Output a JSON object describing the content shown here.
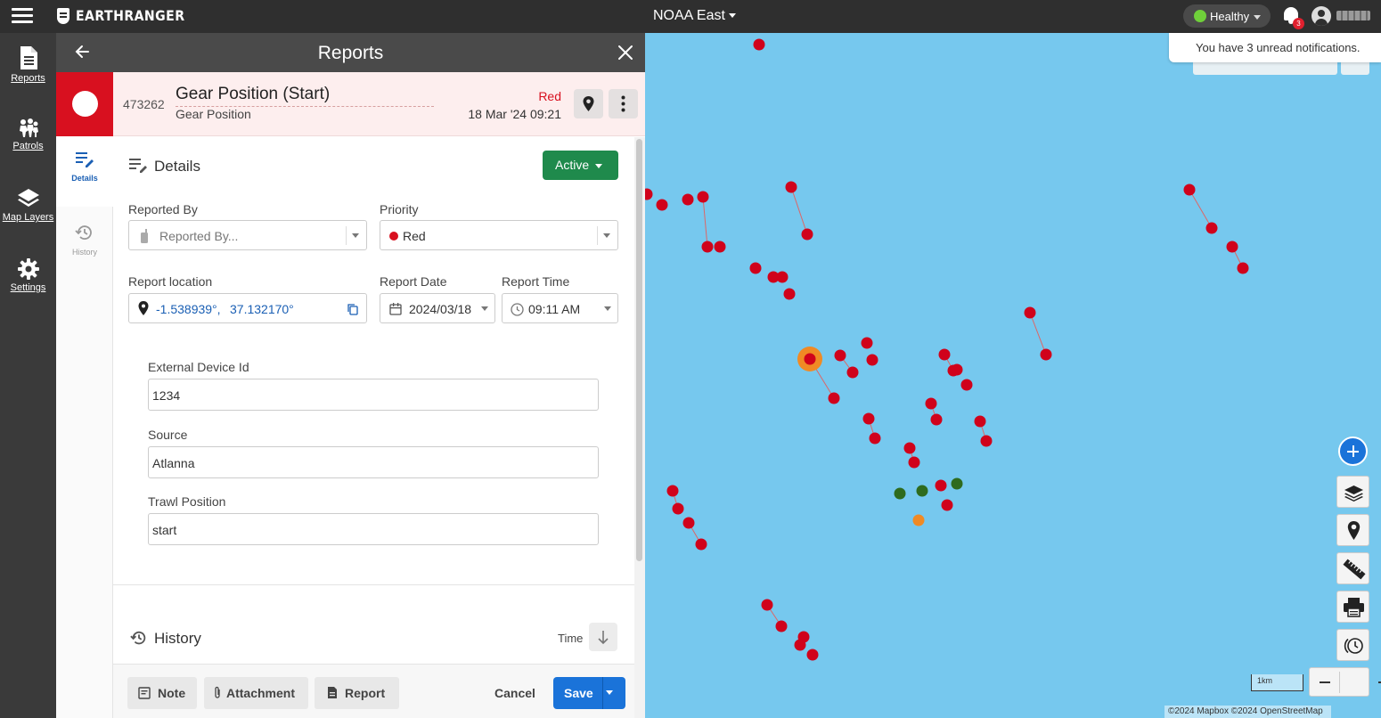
{
  "topbar": {
    "brand": "EARTHRANGER",
    "map_name": "NOAA East",
    "health_status": "Healthy",
    "notification_count": "3"
  },
  "notification_toast": "You have 3 unread notifications.",
  "left_nav": {
    "items": [
      {
        "label": "Reports",
        "icon": "document-icon"
      },
      {
        "label": "Patrols",
        "icon": "patrol-icon"
      },
      {
        "label": "Map Layers",
        "icon": "layers-icon"
      },
      {
        "label": "Settings",
        "icon": "gear-icon"
      }
    ]
  },
  "panel": {
    "title": "Reports",
    "report": {
      "serial": "473262",
      "title": "Gear Position (Start)",
      "type": "Gear Position",
      "priority_label": "Red",
      "date": "18 Mar '24 09:21",
      "priority_color": "#d8101f"
    },
    "subnav": {
      "details": "Details",
      "history": "History"
    },
    "details": {
      "section_title": "Details",
      "status": "Active",
      "reported_by_label": "Reported By",
      "reported_by_placeholder": "Reported By...",
      "priority_label": "Priority",
      "priority_value": "Red",
      "location_label": "Report location",
      "latitude": "-1.538939°,",
      "longitude": "37.132170°",
      "date_label": "Report Date",
      "date_value": "2024/03/18",
      "time_label": "Report Time",
      "time_value": "09:11 AM",
      "external_id_label": "External Device Id",
      "external_id_value": "1234",
      "source_label": "Source",
      "source_value": "Atlanna",
      "trawl_label": "Trawl Position",
      "trawl_value": "start"
    },
    "history": {
      "section_title": "History",
      "sort_label": "Time"
    },
    "footer": {
      "note": "Note",
      "attachment": "Attachment",
      "report": "Report",
      "cancel": "Cancel",
      "save": "Save"
    }
  },
  "map": {
    "scale_label": "1km",
    "attribution": "©2024 Mapbox ©2024 OpenStreetMap",
    "colors": {
      "water": "#76c8ee",
      "red_marker": "#d0021b",
      "green_marker": "#2e6b1e",
      "orange_marker": "#f08a24"
    }
  }
}
